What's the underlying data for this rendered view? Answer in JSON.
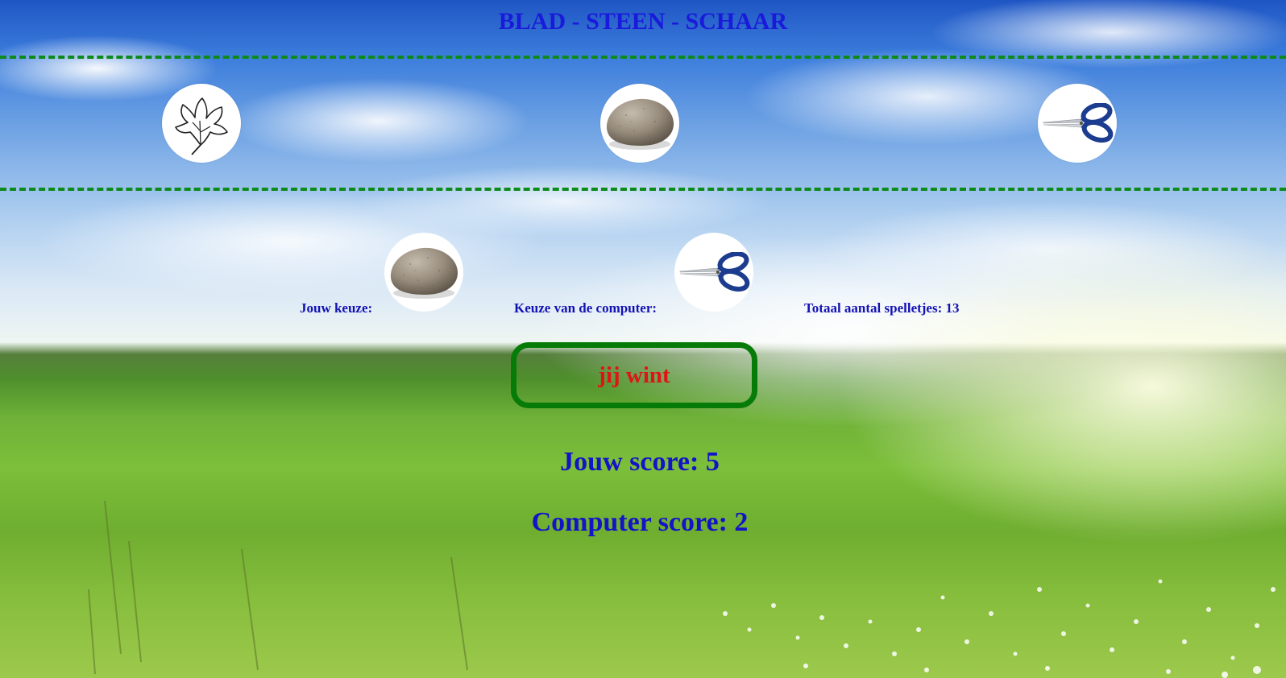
{
  "header": {
    "title": "BLAD - STEEN - SCHAAR"
  },
  "choices": [
    {
      "name": "blad",
      "icon": "leaf-icon"
    },
    {
      "name": "steen",
      "icon": "stone-icon"
    },
    {
      "name": "schaar",
      "icon": "scissors-icon"
    }
  ],
  "round": {
    "player_label": "Jouw keuze:",
    "player_choice_icon": "stone-icon",
    "computer_label": "Keuze van de computer:",
    "computer_choice_icon": "scissors-icon",
    "total_label": "Totaal aantal spelletjes: 13"
  },
  "result": {
    "text": "jij wint"
  },
  "scores": {
    "player": "Jouw score: 5",
    "computer": "Computer score: 2"
  },
  "colors": {
    "title": "#1a1adb",
    "dashes": "#0c8a1c",
    "result_border": "#077b07",
    "result_text": "#e01414",
    "score_text": "#1313c8"
  }
}
